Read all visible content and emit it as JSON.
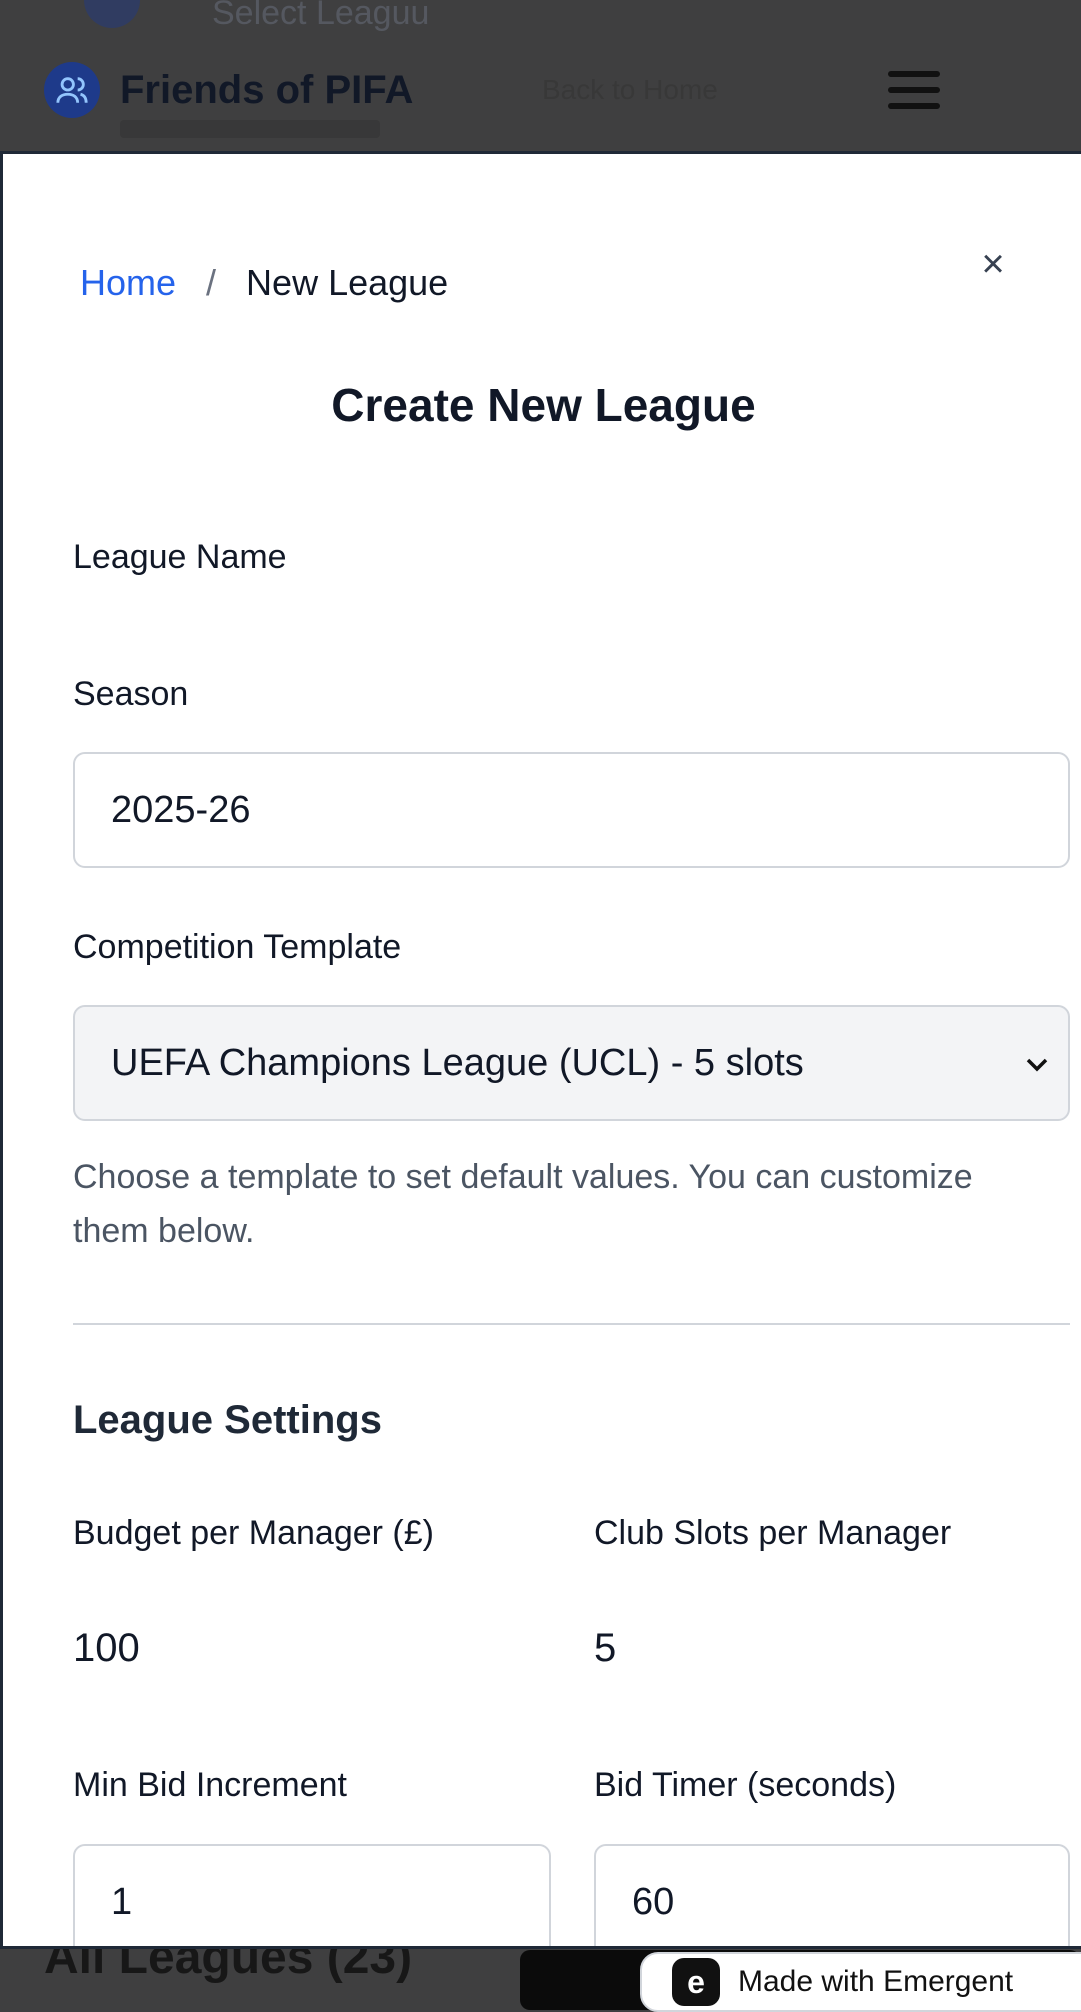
{
  "header": {
    "faint_top_text": "Select Leaguu",
    "brand_title": "Friends of PIFA",
    "faint_link": "Back to Home"
  },
  "modal": {
    "breadcrumb": {
      "home": "Home",
      "separator": "/",
      "current": "New League"
    },
    "title": "Create New League",
    "close_icon": "×",
    "fields": {
      "league_name_label": "League Name",
      "season_label": "Season",
      "season_value": "2025-26",
      "template_label": "Competition Template",
      "template_value": "UEFA Champions League (UCL) - 5 slots",
      "template_helper": "Choose a template to set default values. You can customize them below."
    },
    "settings": {
      "section_title": "League Settings",
      "budget_label": "Budget per Manager (£)",
      "budget_value": "100",
      "club_slots_label": "Club Slots per Manager",
      "club_slots_value": "5",
      "min_bid_label": "Min Bid Increment",
      "min_bid_value": "1",
      "bid_timer_label": "Bid Timer (seconds)",
      "bid_timer_value": "60"
    }
  },
  "background": {
    "bottom_text": "All Leagues (23)",
    "badge_text": "Made with Emergent"
  },
  "colors": {
    "accent": "#2563eb",
    "overlay": "#3f3f40"
  }
}
